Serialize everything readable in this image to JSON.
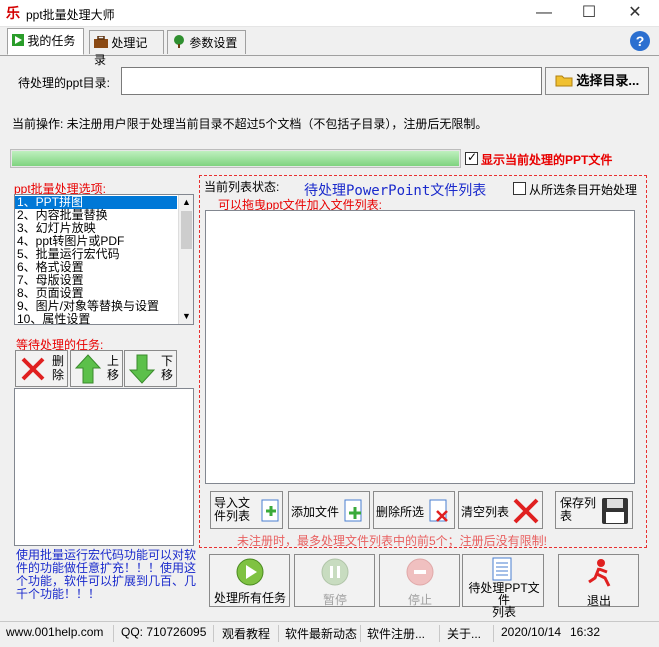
{
  "window": {
    "title": "ppt批量处理大师",
    "minimize": "—",
    "maximize": "☐",
    "close": "✕"
  },
  "tabs": [
    {
      "label": "我的任务",
      "icon": "play-icon"
    },
    {
      "label": "处理记录",
      "icon": "briefcase-icon"
    },
    {
      "label": "参数设置",
      "icon": "tree-icon"
    }
  ],
  "help": "?",
  "dir": {
    "label": "待处理的ppt目录:",
    "value": "",
    "button": "选择目录..."
  },
  "notice": "当前操作: 未注册用户限于处理当前目录不超过5个文档（不包括子目录），注册后无限制。",
  "progress": {
    "value": 1.0
  },
  "show_current": {
    "label": "显示当前处理的PPT文件",
    "checked": true
  },
  "options": {
    "header": "ppt批量处理选项:",
    "items": [
      "1、PPT拼图",
      "2、内容批量替换",
      "3、幻灯片放映",
      "4、ppt转图片或PDF",
      "5、批量运行宏代码",
      "6、格式设置",
      "7、母版设置",
      "8、页面设置",
      "9、图片/对象等替换与设置",
      "10、属性设置"
    ]
  },
  "tasks": {
    "header": "等待处理的任务:",
    "delete": [
      "删",
      "除"
    ],
    "up": [
      "上",
      "移"
    ],
    "down": [
      "下",
      "移"
    ]
  },
  "macro_note": "使用批量运行宏代码功能可以对软件的功能做任意扩充！！！使用这个功能，软件可以扩展到几百、几千个功能！！！",
  "file_list": {
    "status_label": "当前列表状态:",
    "title": "待处理PowerPoint文件列表",
    "from_selected": {
      "label": "从所选条目开始处理",
      "checked": false
    },
    "drag_hint": "可以拖曳ppt文件加入文件列表:",
    "buttons": {
      "import": [
        "导入文",
        "件列表"
      ],
      "add": "添加文件",
      "delete": "删除所选",
      "clear": "清空列表",
      "save": [
        "保存列",
        "表"
      ]
    },
    "limit_note": "未注册时，最多处理文件列表中的前5个；注册后没有限制!"
  },
  "actions": {
    "process_all": "处理所有任务",
    "pause": "暂停",
    "stop": "停止",
    "pending_list": [
      "待处理PPT文件",
      "列表"
    ],
    "exit": "退出"
  },
  "status": {
    "site": "www.001help.com",
    "qq": "QQ: 710726095",
    "tutorial": "观看教程",
    "news": "软件最新动态",
    "register": "软件注册...",
    "about": "关于...",
    "date": "2020/10/14",
    "time": "16:32"
  }
}
